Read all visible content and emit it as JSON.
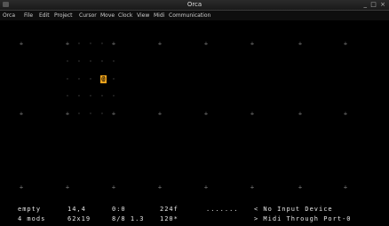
{
  "window": {
    "title": "Orca",
    "controls": {
      "minimize": "_",
      "maximize": "□",
      "close": "×"
    }
  },
  "menubar": [
    "Orca",
    "File",
    "Edit",
    "Project",
    "Cursor",
    "Move",
    "Clock",
    "View",
    "Midi",
    "Communication"
  ],
  "canvas": {
    "grid_marker": "+",
    "dot": "·",
    "cursor_glyph": "@",
    "cursor_color": "#f2a51c"
  },
  "status": {
    "row1": {
      "file": "empty",
      "cursor_pos": "14,4",
      "selection": "0:0",
      "frame": "224f",
      "activity": ".......",
      "midi_input": "< No Input Device"
    },
    "row2": {
      "mods": "4 mods",
      "grid_size": "62x19",
      "grid_ratio": "8/8 1.3",
      "bpm": "120*",
      "midi_output": "> Midi Through Port-0"
    }
  }
}
